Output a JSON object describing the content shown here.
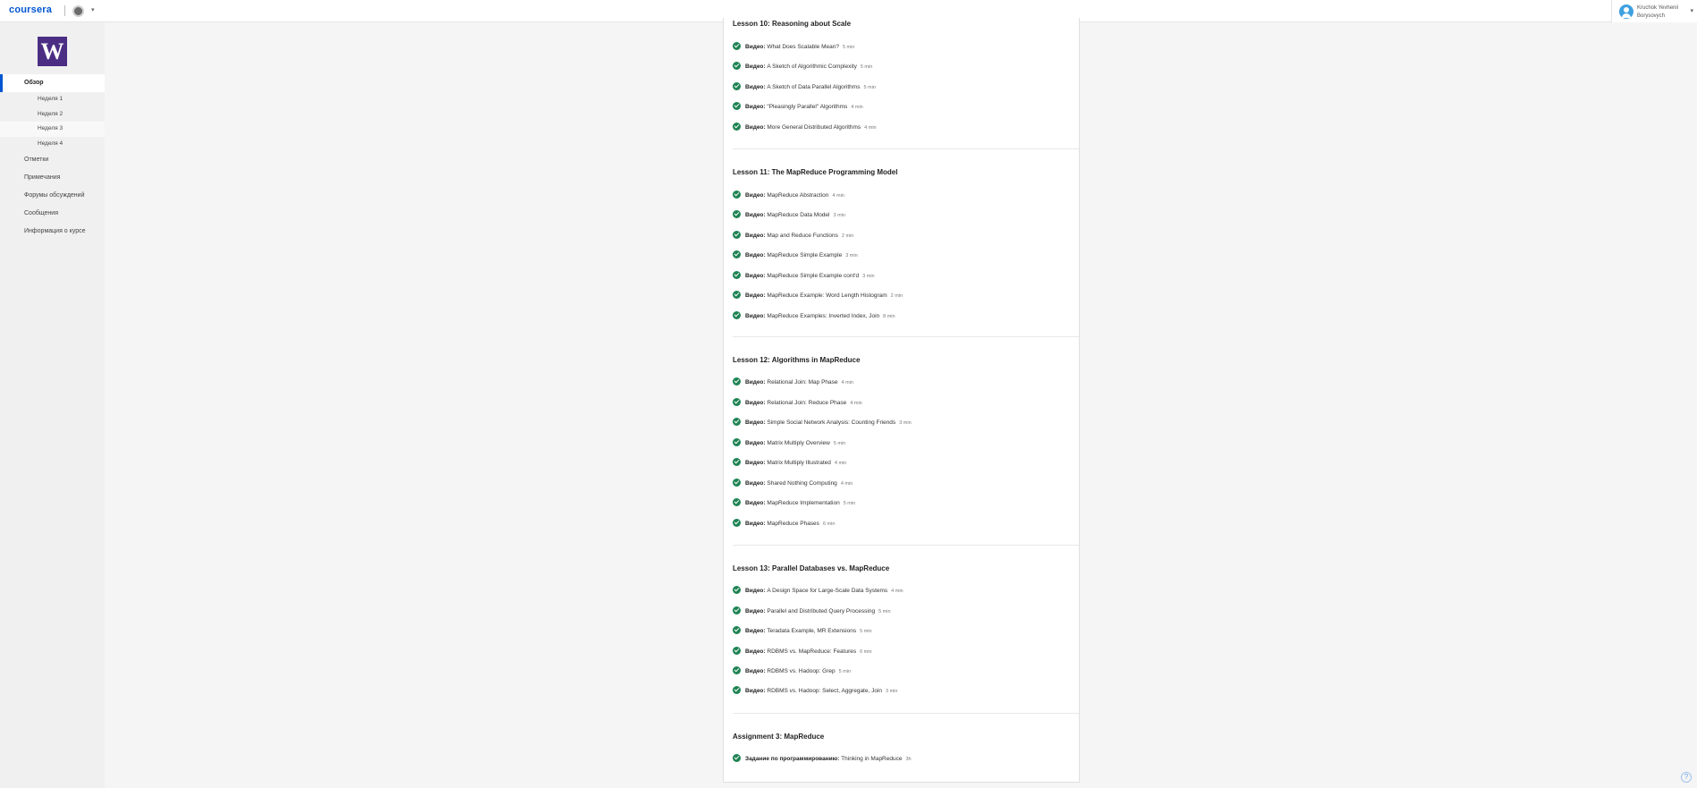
{
  "header": {
    "logo": "coursera",
    "user_line1": "Kruchok Yevhenii",
    "user_line2": "Borysovych"
  },
  "sidebar": {
    "course_logo": "W",
    "items": [
      {
        "label": "Обзор",
        "active": true
      },
      {
        "label": "Неделя 1"
      },
      {
        "label": "Неделя 2"
      },
      {
        "label": "Неделя 3"
      },
      {
        "label": "Неделя 4"
      },
      {
        "label": "Отметки"
      },
      {
        "label": "Примечания"
      },
      {
        "label": "Форумы обсуждений"
      },
      {
        "label": "Сообщения"
      },
      {
        "label": "Информация о курсе"
      }
    ]
  },
  "lessons": [
    {
      "title": "Lesson 10: Reasoning about Scale",
      "items": [
        {
          "type": "Видео:",
          "name": "What Does Scalable Mean?",
          "dur": "5 min"
        },
        {
          "type": "Видео:",
          "name": "A Sketch of Algorithmic Complexity",
          "dur": "5 min"
        },
        {
          "type": "Видео:",
          "name": "A Sketch of Data Parallel Algorithms",
          "dur": "5 min"
        },
        {
          "type": "Видео:",
          "name": "\"Pleasingly Parallel\" Algorithms",
          "dur": "4 min"
        },
        {
          "type": "Видео:",
          "name": "More General Distributed Algorithms",
          "dur": "4 min"
        }
      ]
    },
    {
      "title": "Lesson 11: The MapReduce Programming Model",
      "items": [
        {
          "type": "Видео:",
          "name": "MapReduce Abstraction",
          "dur": "4 min"
        },
        {
          "type": "Видео:",
          "name": "MapReduce Data Model",
          "dur": "3 min"
        },
        {
          "type": "Видео:",
          "name": "Map and Reduce Functions",
          "dur": "2 min"
        },
        {
          "type": "Видео:",
          "name": "MapReduce Simple Example",
          "dur": "3 min"
        },
        {
          "type": "Видео:",
          "name": "MapReduce Simple Example cont'd",
          "dur": "3 min"
        },
        {
          "type": "Видео:",
          "name": "MapReduce Example: Word Length Histogram",
          "dur": "2 min"
        },
        {
          "type": "Видео:",
          "name": "MapReduce Examples: Inverted Index, Join",
          "dur": "8 min"
        }
      ]
    },
    {
      "title": "Lesson 12: Algorithms in MapReduce",
      "items": [
        {
          "type": "Видео:",
          "name": "Relational Join: Map Phase",
          "dur": "4 min"
        },
        {
          "type": "Видео:",
          "name": "Relational Join: Reduce Phase",
          "dur": "4 min"
        },
        {
          "type": "Видео:",
          "name": "Simple Social Network Analysis: Counting Friends",
          "dur": "3 min"
        },
        {
          "type": "Видео:",
          "name": "Matrix Multiply Overview",
          "dur": "5 min"
        },
        {
          "type": "Видео:",
          "name": "Matrix Multiply Illustrated",
          "dur": "4 min"
        },
        {
          "type": "Видео:",
          "name": "Shared Nothing Computing",
          "dur": "4 min"
        },
        {
          "type": "Видео:",
          "name": "MapReduce Implementation",
          "dur": "5 min"
        },
        {
          "type": "Видео:",
          "name": "MapReduce Phases",
          "dur": "6 min"
        }
      ]
    },
    {
      "title": "Lesson 13: Parallel Databases vs. MapReduce",
      "items": [
        {
          "type": "Видео:",
          "name": "A Design Space for Large-Scale Data Systems",
          "dur": "4 min"
        },
        {
          "type": "Видео:",
          "name": "Parallel and Distributed Query Processing",
          "dur": "5 min"
        },
        {
          "type": "Видео:",
          "name": "Teradata Example, MR Extensions",
          "dur": "5 min"
        },
        {
          "type": "Видео:",
          "name": "RDBMS vs. MapReduce: Features",
          "dur": "6 min"
        },
        {
          "type": "Видео:",
          "name": "RDBMS vs. Hadoop: Grep",
          "dur": "5 min"
        },
        {
          "type": "Видео:",
          "name": "RDBMS vs. Hadoop: Select, Aggregate, Join",
          "dur": "3 min"
        }
      ]
    },
    {
      "title": "Assignment 3: MapReduce",
      "items": [
        {
          "type": "Задание по программированию:",
          "name": "Thinking in MapReduce",
          "dur": "3h"
        }
      ]
    }
  ],
  "help": "?"
}
